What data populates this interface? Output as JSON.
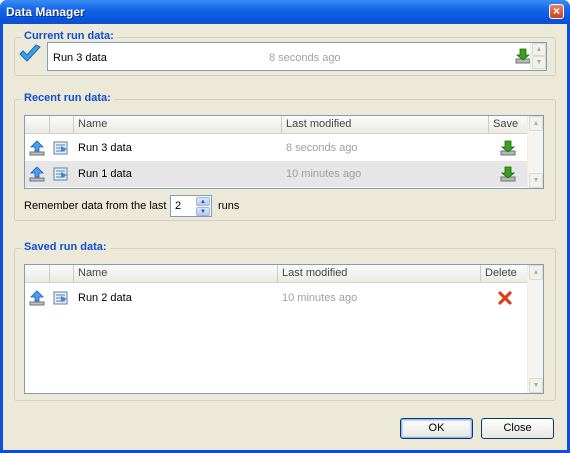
{
  "window": {
    "title": "Data Manager",
    "close_glyph": "×"
  },
  "current": {
    "label": "Current run data:",
    "name": "Run 3 data",
    "modified": "8 seconds ago"
  },
  "recent": {
    "label": "Recent run data:",
    "columns": [
      "Name",
      "Last modified",
      "Save"
    ],
    "rows": [
      {
        "name": "Run 3 data",
        "modified": "8 seconds ago"
      },
      {
        "name": "Run 1 data",
        "modified": "10 minutes ago"
      }
    ],
    "remember_prefix": "Remember data from the last",
    "remember_value": "2",
    "remember_suffix": "runs"
  },
  "saved": {
    "label": "Saved run data:",
    "columns": [
      "Name",
      "Last modified",
      "Delete"
    ],
    "rows": [
      {
        "name": "Run 2 data",
        "modified": "10 minutes ago"
      }
    ]
  },
  "buttons": {
    "ok": "OK",
    "close": "Close"
  },
  "icons": {
    "check": "checkmark-icon",
    "load": "load-arrow-up-icon",
    "view": "view-list-icon",
    "save": "save-download-icon",
    "delete": "delete-x-icon"
  },
  "colors": {
    "titlebar": "#0a55dd",
    "group_label": "#1050d0",
    "client_bg": "#ece9d8",
    "muted_text": "#a0a0a0",
    "delete_red": "#d8401a",
    "save_green": "#3aa020"
  }
}
